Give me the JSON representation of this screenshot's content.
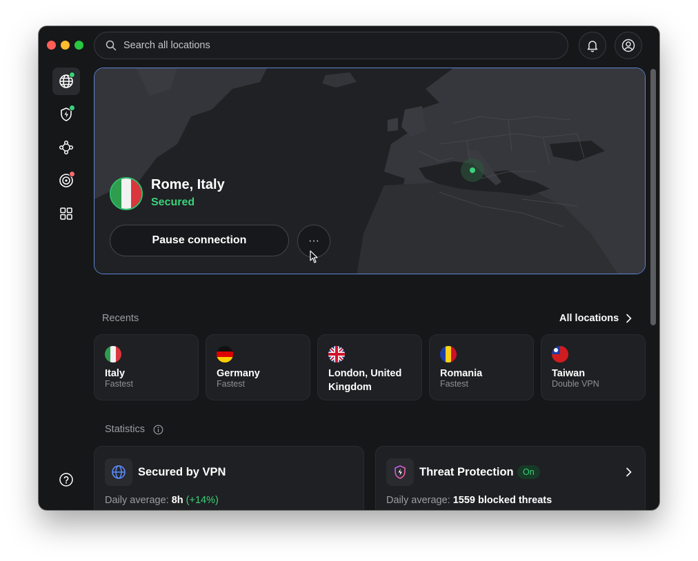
{
  "search": {
    "placeholder": "Search all locations"
  },
  "sidebar": {
    "items": [
      {
        "name": "map",
        "icon": "globe-icon",
        "active": true,
        "badge": "#3bd27a"
      },
      {
        "name": "threat-protection",
        "icon": "shield-bolt-icon",
        "badge": "#3bd27a"
      },
      {
        "name": "meshnet",
        "icon": "meshnet-icon"
      },
      {
        "name": "dark-web-monitor",
        "icon": "radar-icon",
        "badge": "#ff6b6b"
      },
      {
        "name": "apps",
        "icon": "grid-icon"
      }
    ],
    "help_icon": "help-icon"
  },
  "connection": {
    "location": "Rome, Italy",
    "status": "Secured",
    "pause_label": "Pause connection",
    "more_label": "···",
    "status_color": "#3bd27a",
    "accent": "#5d86d4"
  },
  "recents": {
    "label": "Recents",
    "all_label": "All locations",
    "items": [
      {
        "title": "Italy",
        "sub": "Fastest",
        "flag": "italy-flag"
      },
      {
        "title": "Germany",
        "sub": "Fastest",
        "flag": "germany-flag"
      },
      {
        "title": "London, United Kingdom",
        "sub": "",
        "flag": "uk-flag"
      },
      {
        "title": "Romania",
        "sub": "Fastest",
        "flag": "romania-flag"
      },
      {
        "title": "Taiwan",
        "sub": "Double VPN",
        "flag": "taiwan-flag"
      }
    ]
  },
  "statistics": {
    "label": "Statistics",
    "vpn": {
      "title": "Secured by VPN",
      "avg_label": "Daily average:",
      "avg_value": "8h",
      "avg_change": "(+14%)"
    },
    "threat": {
      "title": "Threat Protection",
      "badge": "On",
      "avg_label": "Daily average:",
      "avg_value": "1559 blocked threats"
    }
  }
}
